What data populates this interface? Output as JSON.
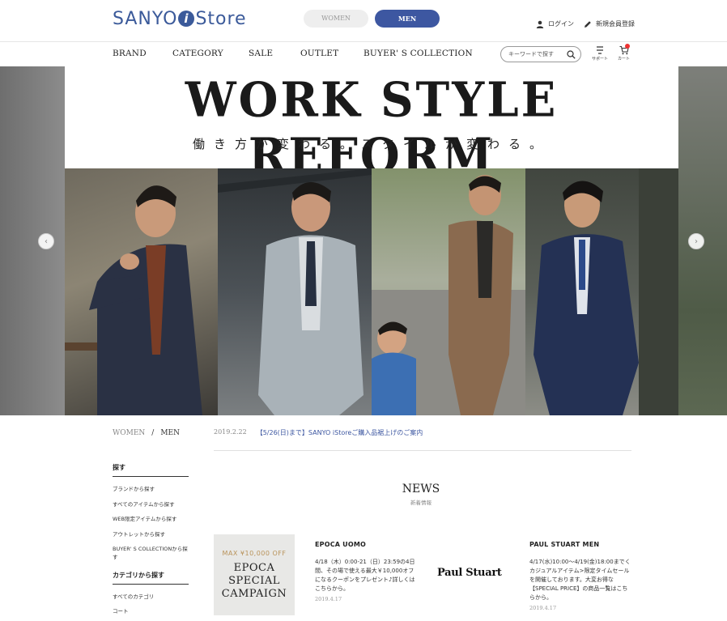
{
  "header": {
    "logo_pre": "SANYO",
    "logo_i": "i",
    "logo_post": "Store",
    "gender": {
      "women": "WOMEN",
      "men": "MEN",
      "selected": "MEN"
    },
    "login_label": "ログイン",
    "register_label": "新規会員登録"
  },
  "nav": {
    "items": [
      {
        "label": "BRAND"
      },
      {
        "label": "CATEGORY"
      },
      {
        "label": "SALE"
      },
      {
        "label": "OUTLET"
      },
      {
        "label": "BUYER' S COLLECTION"
      }
    ],
    "search_placeholder": "キーワードで探す",
    "support_label": "サポート",
    "cart_label": "カート"
  },
  "hero": {
    "title": "WORK STYLE REFORM",
    "subtitle": "働き方が変わる。スタイルが変わる。"
  },
  "breadcrumb": {
    "women": "WOMEN",
    "separator": "/",
    "men": "MEN"
  },
  "notice": {
    "date": "2019.2.22",
    "text": "【5/26(日)まで】SANYO iStoreご購入品裾上げのご案内"
  },
  "sidebar": {
    "search_heading": "探す",
    "search_links": [
      "ブランドから探す",
      "すべてのアイテムから探す",
      "WEB限定アイテムから探す",
      "アウトレットから探す",
      "BUYER' S COLLECTIONから探す"
    ],
    "category_heading": "カテゴリから探す",
    "category_links": [
      "すべてのカテゴリ",
      "コート"
    ]
  },
  "news": {
    "title": "NEWS",
    "subtitle": "新着情報",
    "campaign_image": {
      "top": "MAX ¥10,000 OFF",
      "line1": "EPOCA",
      "line2": "SPECIAL",
      "line3": "CAMPAIGN"
    },
    "items": [
      {
        "brand": "EPOCA UOMO",
        "body": "4/18（木）0:00-21（日）23:59の4日間、その場で使える最大￥10,000オフになるクーポンをプレゼント♪詳しくはこちらから。",
        "date": "2019.4.17"
      },
      {
        "brand": "PAUL STUART MEN",
        "body": "4/17(水)10:00～4/19(金)18:00までくカジュアルアイテム>限定タイムセールを開催しております。大変お得な【SPECIAL PRICE】の商品一覧はこちらから。",
        "date": "2019.4.17"
      }
    ],
    "logo_text": "Paul Stuart"
  },
  "colors": {
    "accent": "#3d57a1",
    "logo": "#3b5a9a"
  }
}
